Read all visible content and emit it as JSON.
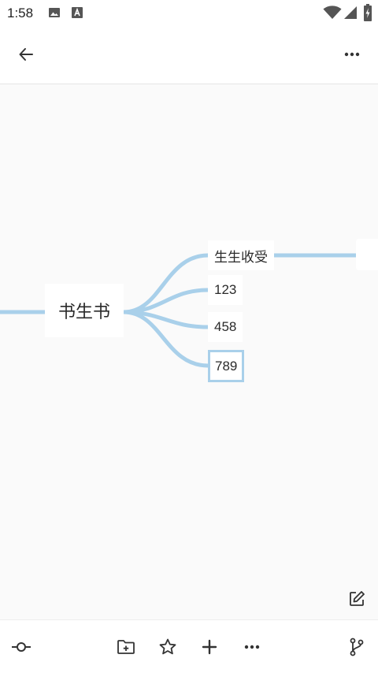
{
  "status_bar": {
    "time": "1:58",
    "icons": [
      "image-icon",
      "a-icon",
      "wifi-icon",
      "signal-icon",
      "battery-icon"
    ]
  },
  "app_bar": {
    "back_icon": "arrow-left-icon",
    "menu_icon": "more-horizontal-icon"
  },
  "mindmap": {
    "root": "书生书",
    "children": [
      "生生收受",
      "123",
      "458",
      "789"
    ],
    "selected_child": "789"
  },
  "colors": {
    "branch": "#a9d0ea",
    "background": "#fafafa",
    "node": "#ffffff"
  },
  "toolbar": {
    "items": [
      "node-style-icon",
      "folder-add-icon",
      "star-icon",
      "add-icon",
      "more-icon",
      "branch-icon"
    ]
  },
  "edit_icon": "edit-icon"
}
